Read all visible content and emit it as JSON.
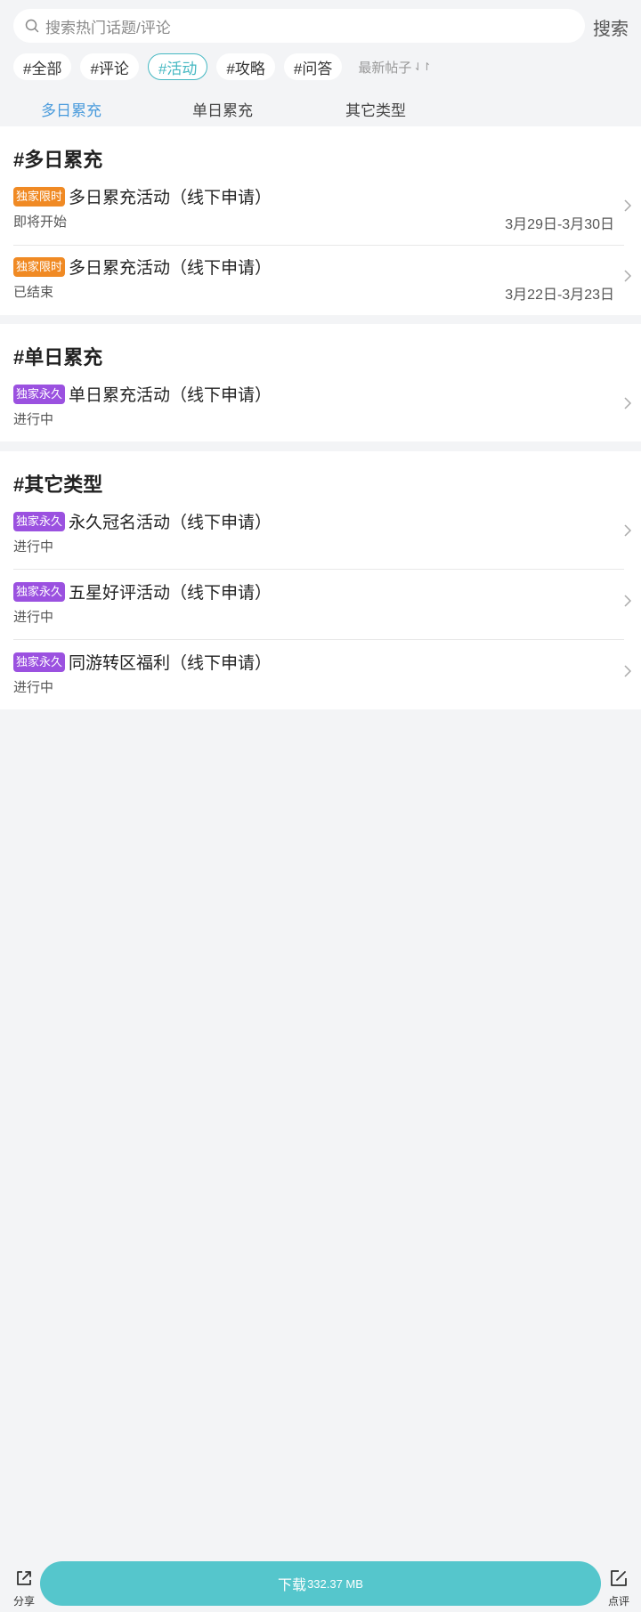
{
  "search": {
    "placeholder": "搜索热门话题/评论",
    "button": "搜索"
  },
  "tags": [
    "#全部",
    "#评论",
    "#活动",
    "#攻略",
    "#问答"
  ],
  "active_tag": "#活动",
  "sort": {
    "label": "最新帖子",
    "icon": "sort-arrows-icon"
  },
  "tabs": [
    "多日累充",
    "单日累充",
    "其它类型"
  ],
  "active_tab": "多日累充",
  "sections": [
    {
      "heading": "#多日累充",
      "items": [
        {
          "badge": "独家限时",
          "badge_color": "#f08a24",
          "title": "多日累充活动（线下申请）",
          "status": "即将开始",
          "date": "3月29日-3月30日"
        },
        {
          "badge": "独家限时",
          "badge_color": "#f08a24",
          "title": "多日累充活动（线下申请）",
          "status": "已结束",
          "date": "3月22日-3月23日"
        }
      ]
    },
    {
      "heading": "#单日累充",
      "items": [
        {
          "badge": "独家永久",
          "badge_color": "#9b51e0",
          "title": "单日累充活动（线下申请）",
          "status": "进行中"
        }
      ]
    },
    {
      "heading": "#其它类型",
      "items": [
        {
          "badge": "独家永久",
          "badge_color": "#9b51e0",
          "title": "永久冠名活动（线下申请）",
          "status": "进行中"
        },
        {
          "badge": "独家永久",
          "badge_color": "#9b51e0",
          "title": "五星好评活动（线下申请）",
          "status": "进行中"
        },
        {
          "badge": "独家永久",
          "badge_color": "#9b51e0",
          "title": "同游转区福利（线下申请）",
          "status": "进行中"
        }
      ]
    }
  ],
  "bottom": {
    "share_label": "分享",
    "download_label": "下载",
    "download_size": "332.37 MB",
    "review_label": "点评"
  },
  "colors": {
    "accent": "#55c6cc",
    "tag_active": "#45b8c2",
    "tab_active": "#4a9bdc"
  }
}
